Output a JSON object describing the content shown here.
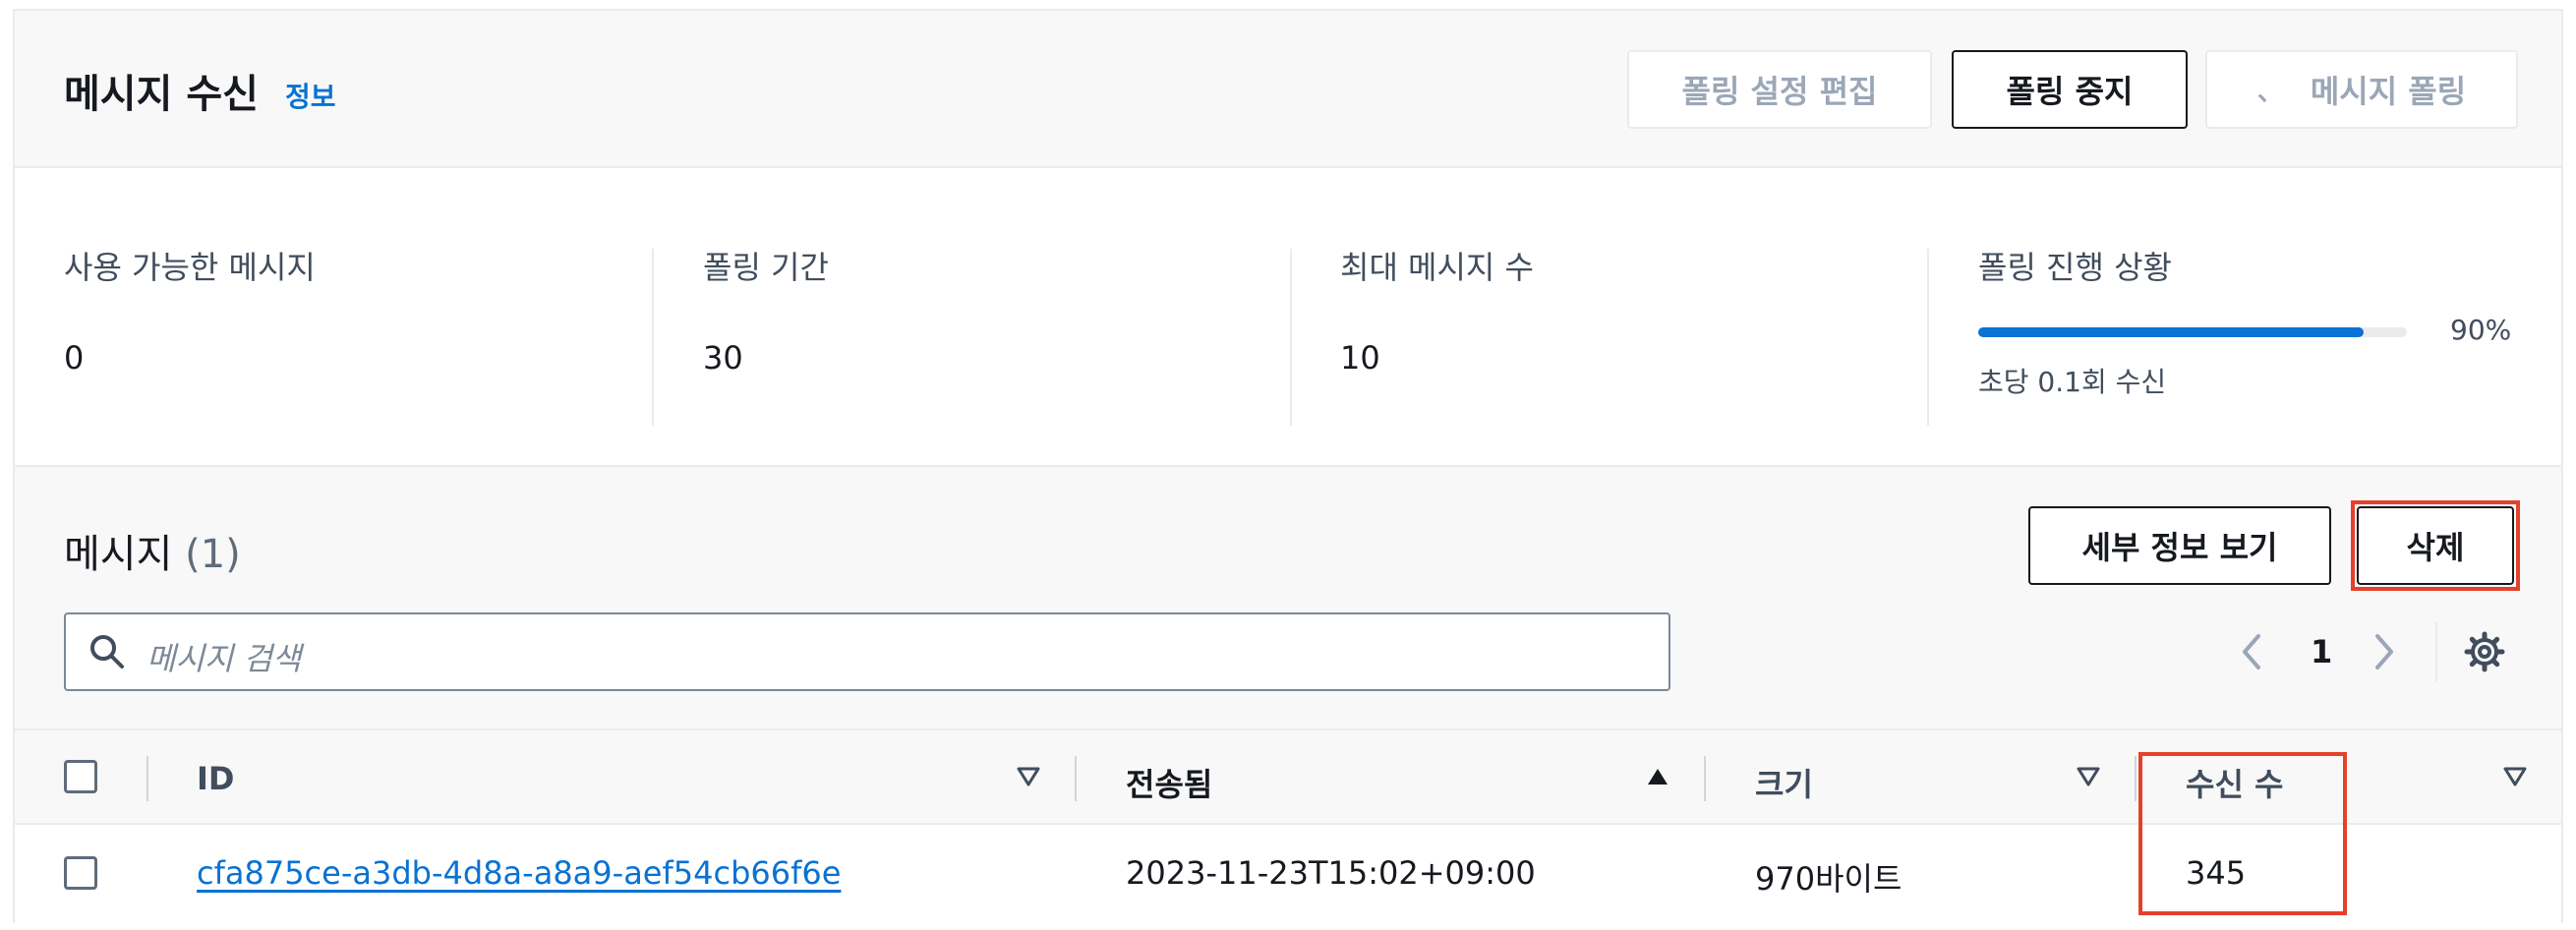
{
  "header": {
    "title": "메시지 수신",
    "info_link": "정보",
    "edit_polling_label": "폴링 설정 편집",
    "stop_polling_label": "폴링 중지",
    "poll_messages_label": "메시지 폴링"
  },
  "stats": {
    "available": {
      "label": "사용 가능한 메시지",
      "value": "0"
    },
    "duration": {
      "label": "폴링 기간",
      "value": "30"
    },
    "max_count": {
      "label": "최대 메시지 수",
      "value": "10"
    },
    "progress": {
      "label": "폴링 진행 상황",
      "percent_text": "90%",
      "percent": 90,
      "rate_text": "초당 0.1회 수신"
    }
  },
  "messages": {
    "title": "메시지",
    "count_text": "(1)",
    "view_details_label": "세부 정보 보기",
    "delete_label": "삭제",
    "search_placeholder": "메시지 검색",
    "page": "1",
    "columns": [
      "ID",
      "전송됨",
      "크기",
      "수신 수"
    ],
    "rows": [
      {
        "id": "cfa875ce-a3db-4d8a-a8a9-aef54cb66f6e",
        "sent": "2023-11-23T15:02+09:00",
        "size": "970바이트",
        "receive_count": "345"
      }
    ]
  },
  "colors": {
    "accent": "#0972d3",
    "highlight": "#e4412b",
    "text": "#16191f",
    "disabled": "#9ba7b6"
  },
  "icons": [
    "search-icon",
    "chevron-left-icon",
    "chevron-right-icon",
    "gear-icon",
    "sort-down-icon",
    "sort-up-icon",
    "checkbox-icon"
  ]
}
